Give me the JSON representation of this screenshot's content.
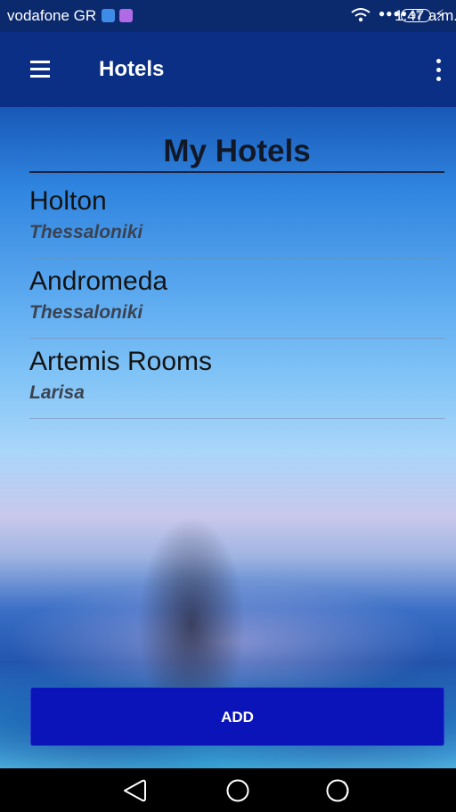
{
  "status_bar": {
    "carrier": "vodafone GR",
    "battery": "97",
    "time": "1:47 a.m."
  },
  "app_bar": {
    "title": "Hotels"
  },
  "page": {
    "title": "My Hotels"
  },
  "hotels": [
    {
      "name": "Holton",
      "city": "Thessaloniki"
    },
    {
      "name": "Andromeda",
      "city": "Thessaloniki"
    },
    {
      "name": "Artemis Rooms",
      "city": "Larisa"
    }
  ],
  "actions": {
    "add_label": "ADD"
  },
  "icons": {
    "menu": "hamburger-menu-icon",
    "overflow": "more-vert-icon",
    "wifi": "wifi-icon",
    "signal": "signal-icon",
    "battery": "battery-icon",
    "charging": "charging-bolt-icon",
    "back": "back-triangle-icon",
    "home": "home-circle-icon",
    "recent": "recent-apps-icon"
  },
  "colors": {
    "status_bar": "#0b2a6e",
    "app_bar": "#0b2f84",
    "add_button": "#0a14b8"
  }
}
